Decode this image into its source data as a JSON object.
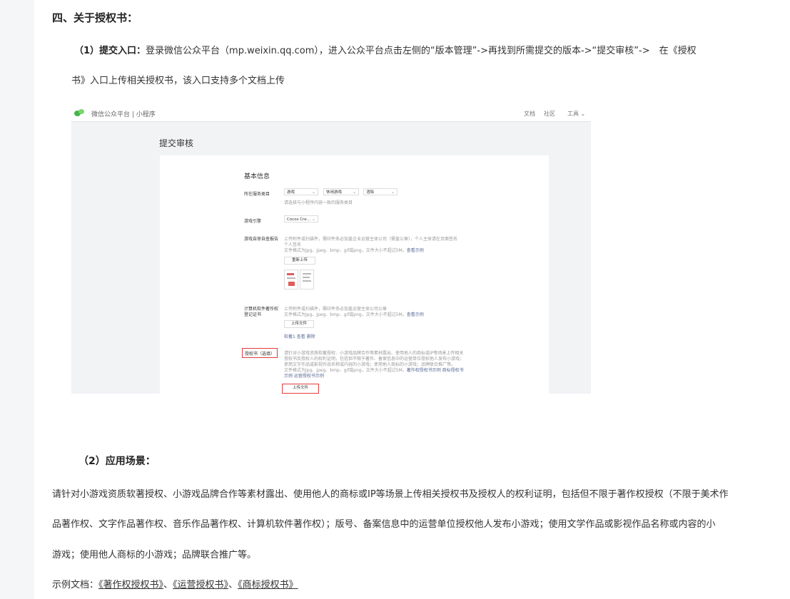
{
  "section_heading": "四、关于授权书：",
  "step1": {
    "label": "（1）提交入口：",
    "text_line1": "登录微信公众平台（mp.weixin.qq.com），进入公众平台点击左侧的“版本管理”->再找到所需提交的版本->“提交审核”->　在《授权",
    "text_line2": "书》入口上传相关授权书，该入口支持多个文档上传"
  },
  "screenshot": {
    "nav_title": "微信公众平台 | 小程序",
    "nav_links": [
      "文档",
      "社区",
      "工具 ⌄"
    ],
    "page_title": "提交审核",
    "section_title": "基本信息",
    "service_category_label": "所在服务类目",
    "service_category_options": [
      "游戏",
      "休闲游戏",
      "消除"
    ],
    "service_category_hint": "请选择与小程序内容一致的服务类目",
    "engine_label": "游戏引擎",
    "engine_value": "Cocos Cre...",
    "record_label": "游戏自审自查报告",
    "record_hint_1": "上传附件或扫描件，需印件务必加盖企业运营主体公司（需盖公章），个人主体请在页面签名",
    "record_hint_2": "个人签名",
    "record_format": "文件格式为jpg、jpeg、bmp、gif或png，文件大小不超过5M。",
    "view_example": "查看示例",
    "reupload_button": "重新上传",
    "software_label_1": "计算机软件著作权",
    "software_label_2": "登记证书",
    "software_hint": "上传附件或扫描件，需印件务必加盖运营主体公司公章",
    "software_format": "文件格式为jpg、jpeg、bmp、gif或png，文件大小不超过5M。",
    "upload_button": "上传文件",
    "uploaded_file": "软著1 查看 删除",
    "auth_label": "授权书（选填）",
    "auth_desc_1": "请针对小游戏资质软著授权、小游戏品牌合作等素材露出、使用他人的商标或IP等场景上传相关",
    "auth_desc_2": "授权书及授权人的权利证明，包括但不限于著作、备案信息中的运营单位授权他人发布小游戏；",
    "auth_desc_3": "使用文字作品或影视作品名称或内容的小游戏；使用他人商标的小游戏；品牌联合推广等。",
    "auth_format": "文件格式为jpg、jpeg、bmp、gif或png，文件大小不超过5M。",
    "auth_links_1": "著作权授权书示例 商标授权书",
    "auth_links_2": "示例 运营授权书示例",
    "auth_upload_button": "上传文件",
    "highlight_color": "#e23b3b"
  },
  "step2": {
    "label": "（2）应用场景：",
    "line1": "请针对小游戏资质软著授权、小游戏品牌合作等素材露出、使用他人的商标或IP等场景上传相关授权书及授权人的权利证明，包括但不限于著作权授权（不限于美术作",
    "line2": "品著作权、文字作品著作权、音乐作品著作权、计算机软件著作权）；版号、备案信息中的运营单位授权他人发布小游戏；使用文学作品或影视作品名称或内容的小",
    "line3": "游戏；使用他人商标的小游戏；品牌联合推广等。"
  },
  "examples": {
    "prefix": "示例文档：",
    "links": [
      "《著作权授权书》",
      "《运营授权书》",
      "《商标授权书》"
    ],
    "sep": "、"
  }
}
